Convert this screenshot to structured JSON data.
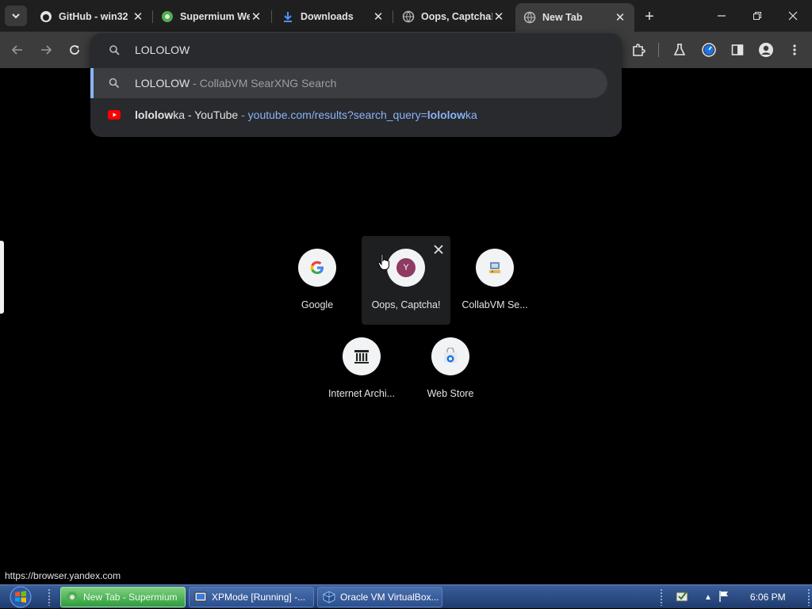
{
  "tabs": [
    {
      "title": "GitHub - win32",
      "icon": "github-icon"
    },
    {
      "title": "Supermium We",
      "icon": "supermium-icon"
    },
    {
      "title": "Downloads",
      "icon": "download-icon"
    },
    {
      "title": "Oops, Captcha!",
      "icon": "globe-icon"
    },
    {
      "title": "New Tab",
      "icon": "globe-icon",
      "active": true
    }
  ],
  "omnibox": {
    "input_text": "LOLOLOW",
    "suggestions": [
      {
        "main": "LOLOLOW",
        "separator": " - ",
        "secondary": "CollabVM SearXNG Search",
        "icon": "search-icon"
      },
      {
        "main_bold": "lololow",
        "main_rest": "ka - YouTube",
        "separator": " - ",
        "url_prefix": "youtube.com/results?search_query=",
        "url_bold": "lololow",
        "url_suffix": "ka",
        "icon": "youtube-icon"
      }
    ]
  },
  "shortcuts": [
    {
      "label": "Google",
      "icon": "google-icon"
    },
    {
      "label": "Oops, Captcha!",
      "icon": "letter-y-icon",
      "letter": "Y"
    },
    {
      "label": "CollabVM Se...",
      "icon": "collabvm-icon"
    },
    {
      "label": "Internet Archi...",
      "icon": "archive-icon"
    },
    {
      "label": "Web Store",
      "icon": "webstore-icon"
    }
  ],
  "status_url": "https://browser.yandex.com",
  "taskbar": {
    "buttons": [
      {
        "label": "New Tab - Supermium",
        "active": true
      },
      {
        "label": "XPMode [Running] -..."
      },
      {
        "label": "Oracle VM VirtualBox..."
      }
    ],
    "clock": "6:06 PM"
  },
  "colors": {
    "accent": "#8ab4f8",
    "active_tab": "#3c3c3c",
    "omnibox_bg": "#282a2d",
    "youtube_red": "#ff0000"
  }
}
